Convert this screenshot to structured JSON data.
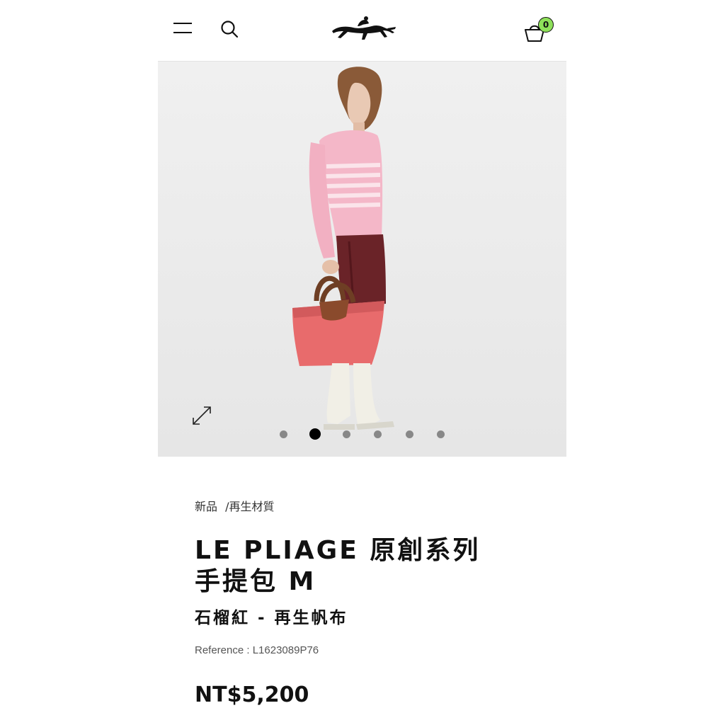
{
  "header": {
    "menu_icon": "menu-icon",
    "search_icon": "search-icon",
    "logo": "longchamp-horse-jockey-logo",
    "cart_icon": "basket-icon",
    "cart_count": "0",
    "cart_badge_color": "#8ee05a"
  },
  "gallery": {
    "image": "model in pink striped sweater holding a pink Le Pliage bag",
    "expand_icon": "expand-icon",
    "slide_count": 6,
    "active_slide": 2
  },
  "product": {
    "breadcrumb": [
      "新品",
      "/再生材質"
    ],
    "title_line1": "LE PLIAGE 原創系列",
    "title_line2": "手提包 M",
    "subtitle": "石榴紅 - 再生帆布",
    "reference": "Reference : L1623089P76",
    "price": "NT$5,200"
  }
}
